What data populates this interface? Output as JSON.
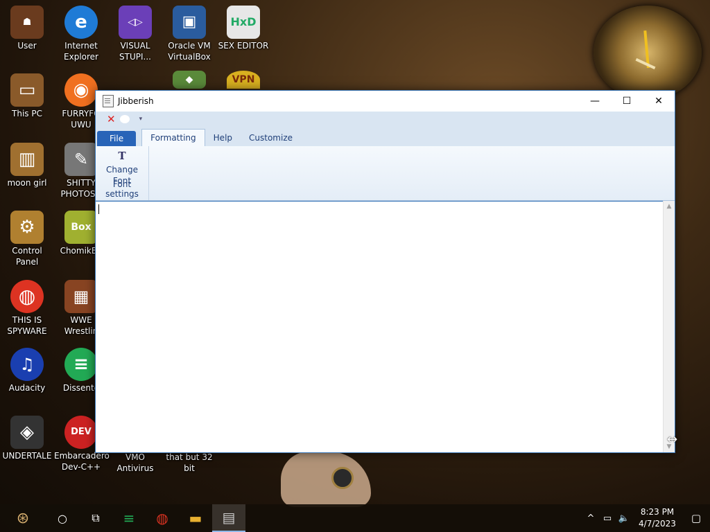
{
  "desktop": {
    "icons": [
      {
        "label": "User",
        "color": "#6a3b1e",
        "glyph": "☗"
      },
      {
        "label": "Internet Explorer",
        "color": "#1f7bd6",
        "glyph": "e"
      },
      {
        "label": "VISUAL STUPI...",
        "color": "#6b3fb8",
        "glyph": "◁▷"
      },
      {
        "label": "Oracle VM VirtualBox",
        "color": "#2a5c9e",
        "glyph": "▣"
      },
      {
        "label": "SEX EDITOR",
        "color": "#e7e7e7",
        "glyph": "HxD"
      },
      {
        "label": "This PC",
        "color": "#8a5a2a",
        "glyph": "▭"
      },
      {
        "label": "FURRYFO UWU",
        "color": "#f07020",
        "glyph": "◉"
      },
      {
        "label": "moon girl",
        "color": "#a07030",
        "glyph": "▥"
      },
      {
        "label": "SHITTY PHOTOSH",
        "color": "#777777",
        "glyph": "✎"
      },
      {
        "label": "Control Panel",
        "color": "#b08030",
        "glyph": "⚙"
      },
      {
        "label": "ChomikBo",
        "color": "#a0b030",
        "glyph": "Box"
      },
      {
        "label": "THIS IS SPYWARE",
        "color": "#dd3322",
        "glyph": "◍"
      },
      {
        "label": "WWE Wrestlin",
        "color": "#884422",
        "glyph": "▦"
      },
      {
        "label": "Audacity",
        "color": "#1a3fb0",
        "glyph": "♫"
      },
      {
        "label": "Dissente",
        "color": "#22aa55",
        "glyph": "≡"
      },
      {
        "label": "UNDERTALE",
        "color": "#333333",
        "glyph": "◈"
      },
      {
        "label": "Embarcadero Dev-C++",
        "color": "#cc2222",
        "glyph": "DEV"
      },
      {
        "label": "VMO Antivirus",
        "color": "transparent",
        "glyph": ""
      },
      {
        "label": "that but 32 bit",
        "color": "transparent",
        "glyph": ""
      },
      {
        "label": "",
        "color": "#5a8a3a",
        "glyph": "◆"
      },
      {
        "label": "",
        "color": "#d8b020",
        "glyph": "VPN"
      }
    ]
  },
  "window": {
    "title": "Jibberish",
    "controls": {
      "minimize": "—",
      "maximize": "☐",
      "close": "✕"
    },
    "quick_access": {
      "close_glyph": "✕",
      "dropdown_glyph": "▾"
    },
    "tabs": [
      {
        "label": "File"
      },
      {
        "label": "Formatting"
      },
      {
        "label": "Help"
      },
      {
        "label": "Customize"
      }
    ],
    "ribbon": {
      "group_label": "Font settings",
      "button_label_1": "Change",
      "button_label_2": "Font",
      "button_glyph": "T"
    },
    "editor": {
      "text": ""
    }
  },
  "taskbar": {
    "start_glyph": "⊛",
    "search_glyph": "○",
    "taskview_glyph": "⧉",
    "apps": [
      {
        "name": "Dissenter",
        "glyph": "≡",
        "color": "#22aa55"
      },
      {
        "name": "Chrome",
        "glyph": "◍",
        "color": "#dd3322"
      },
      {
        "name": "File Explorer",
        "glyph": "▬",
        "color": "#e8b030"
      },
      {
        "name": "Jibberish",
        "glyph": "▤",
        "color": "#cccccc"
      }
    ],
    "tray": {
      "chevron": "^",
      "network": "▭",
      "volume": "🔈",
      "time": "8:23 PM",
      "date": "4/7/2023",
      "notification": "▢"
    }
  }
}
